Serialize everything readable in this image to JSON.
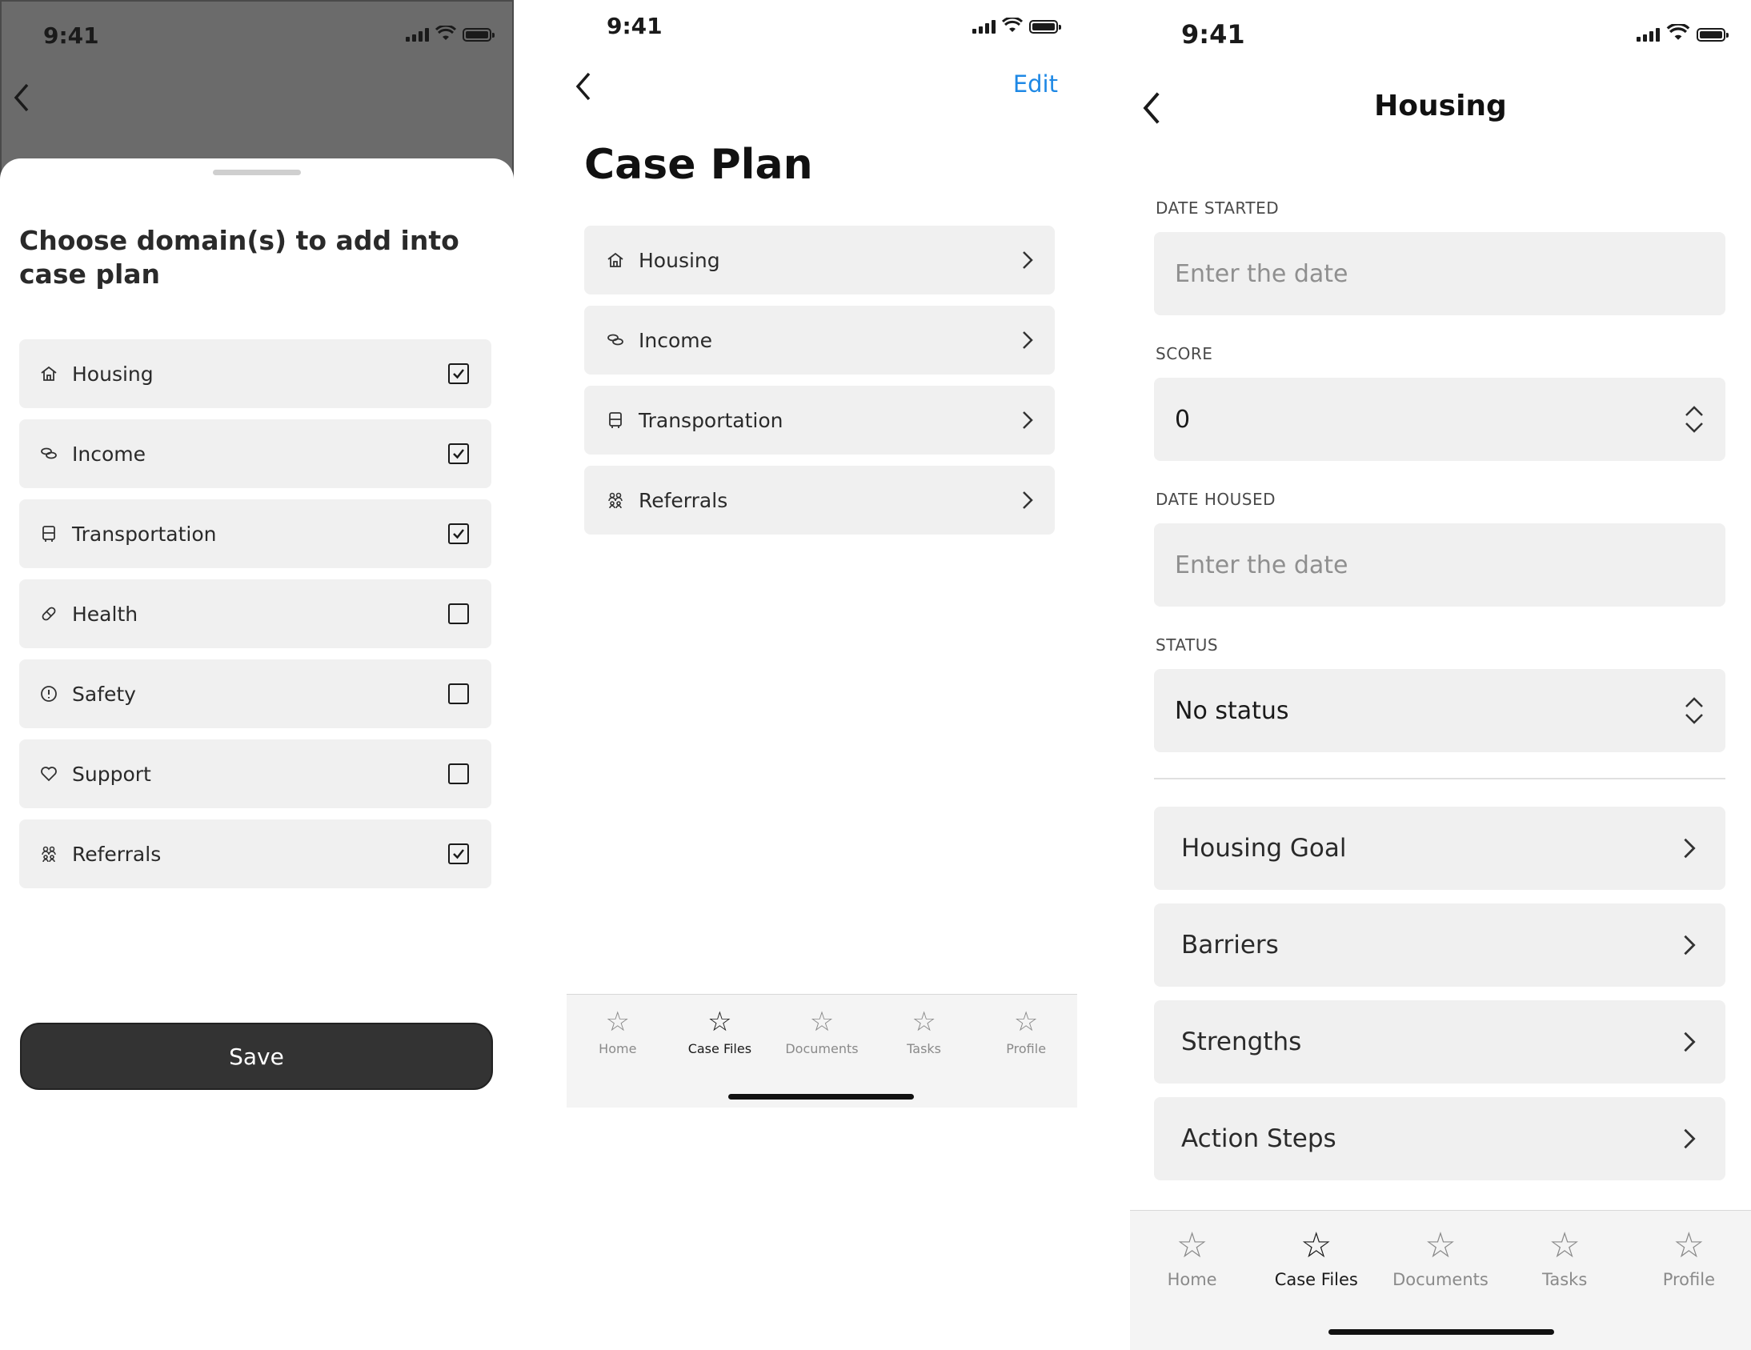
{
  "screen1": {
    "status_time": "9:41",
    "title": "Choose domain(s) to add into case plan",
    "domains": [
      {
        "label": "Housing",
        "icon": "home-icon",
        "checked": true
      },
      {
        "label": "Income",
        "icon": "coins-icon",
        "checked": true
      },
      {
        "label": "Transportation",
        "icon": "bus-icon",
        "checked": true
      },
      {
        "label": "Health",
        "icon": "pill-icon",
        "checked": false
      },
      {
        "label": "Safety",
        "icon": "alert-circle-icon",
        "checked": false
      },
      {
        "label": "Support",
        "icon": "heart-icon",
        "checked": false
      },
      {
        "label": "Referrals",
        "icon": "people-icon",
        "checked": true
      }
    ],
    "save_label": "Save"
  },
  "screen2": {
    "status_time": "9:41",
    "edit_label": "Edit",
    "title": "Case Plan",
    "items": [
      {
        "label": "Housing",
        "icon": "home-icon"
      },
      {
        "label": "Income",
        "icon": "coins-icon"
      },
      {
        "label": "Transportation",
        "icon": "bus-icon"
      },
      {
        "label": "Referrals",
        "icon": "people-icon"
      }
    ]
  },
  "screen3": {
    "status_time": "9:41",
    "title": "Housing",
    "date_started": {
      "label": "DATE STARTED",
      "placeholder": "Enter the date"
    },
    "score": {
      "label": "SCORE",
      "value": "0"
    },
    "date_housed": {
      "label": "DATE HOUSED",
      "placeholder": "Enter the date"
    },
    "status": {
      "label": "STATUS",
      "value": "No status"
    },
    "sections": [
      {
        "label": "Housing Goal"
      },
      {
        "label": "Barriers"
      },
      {
        "label": "Strengths"
      },
      {
        "label": "Action Steps"
      }
    ]
  },
  "tabbar": {
    "items": [
      {
        "label": "Home",
        "icon": "star-icon",
        "active": false
      },
      {
        "label": "Case Files",
        "icon": "star-icon",
        "active": true
      },
      {
        "label": "Documents",
        "icon": "star-icon",
        "active": false
      },
      {
        "label": "Tasks",
        "icon": "star-icon",
        "active": false
      },
      {
        "label": "Profile",
        "icon": "star-icon",
        "active": false
      }
    ]
  },
  "colors": {
    "accent": "#1e88e5",
    "row_background": "#f0f0f0",
    "button_dark": "#333333",
    "overlay": "#6b6b6b"
  }
}
